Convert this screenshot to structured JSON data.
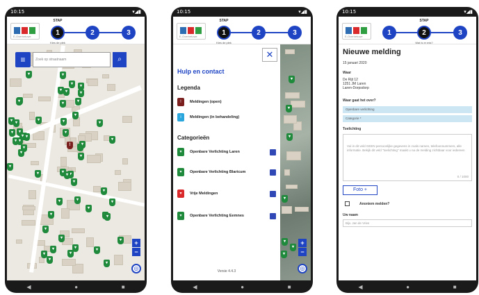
{
  "status_time": "10:15",
  "logo_sub": "E-Overbetuwe",
  "steps": {
    "label": "STAP",
    "numbers": [
      "1",
      "2",
      "3"
    ],
    "step1_sub": "Kies de plek",
    "step2_sub": "Wat is er mis?"
  },
  "nav_icons": [
    "back-icon",
    "home-icon",
    "recent-icon"
  ],
  "screen1": {
    "search_placeholder": "Zoek op straatnaam",
    "zoom_in": "+",
    "zoom_out": "−"
  },
  "screen2": {
    "close": "✕",
    "title": "Hulp en contact",
    "legend_heading": "Legenda",
    "legend": [
      {
        "label": "Meldingen (open)",
        "color": "#7a1e1e"
      },
      {
        "label": "Meldingen (in behandeling)",
        "color": "#2aa6dc"
      }
    ],
    "categories_heading": "Categorieën",
    "categories": [
      {
        "label": "Openbare Verlichting Laren",
        "color": "#1f8a3c"
      },
      {
        "label": "Openbare Verlichting Blaricum",
        "color": "#1f8a3c"
      },
      {
        "label": "Vrije Meldingen",
        "color": "#d9292a"
      },
      {
        "label": "Openbare Verlichting Eemnes",
        "color": "#1f8a3c"
      }
    ],
    "version": "Versie 4.4.3"
  },
  "screen3": {
    "title": "Nieuwe melding",
    "date": "15 januari 2020",
    "location_label": "Waar",
    "address": [
      "De Rijt 12",
      "1251 JM Laren",
      "Laren-Dorpsdorp"
    ],
    "what_label": "Waar gaat het over?",
    "select_category": "Openbare verlichting",
    "select_subcategory": "Categorie *",
    "note_label": "Toelichting",
    "note_placeholder": "Vul in dit veld GEEN persoonlijke gegevens in zoals namen, telefoonnummers, alle informatie. Bekijk dit veld \"toelichting\" maakt u na de melding zichtbaar voor iedereen",
    "note_counter": "0 / 1000",
    "photo_button": "Foto +",
    "anonymous_label": "Anoniem melden?",
    "name_label": "Uw naam",
    "name_placeholder": "Bijv. Jan de Vries"
  }
}
